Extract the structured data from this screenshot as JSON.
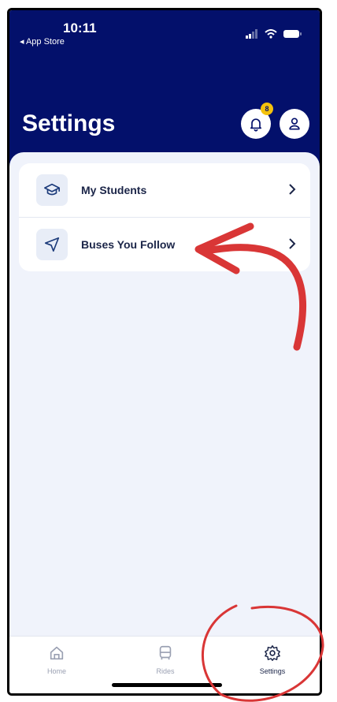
{
  "status_bar": {
    "time": "10:11",
    "back_label": "◂ App Store"
  },
  "header": {
    "title": "Settings",
    "notification_count": "8",
    "bell_icon": "bell-icon",
    "profile_icon": "user-icon"
  },
  "settings_list": [
    {
      "label": "My Students",
      "icon": "graduation-cap-icon"
    },
    {
      "label": "Buses You Follow",
      "icon": "navigation-arrow-icon"
    }
  ],
  "tabbar": {
    "items": [
      {
        "label": "Home",
        "icon": "home-icon",
        "active": false
      },
      {
        "label": "Rides",
        "icon": "bus-icon",
        "active": false
      },
      {
        "label": "Settings",
        "icon": "gear-icon",
        "active": true
      }
    ]
  },
  "colors": {
    "header_bg": "#03106b",
    "badge": "#f4c20d",
    "annotation": "#d93636"
  }
}
